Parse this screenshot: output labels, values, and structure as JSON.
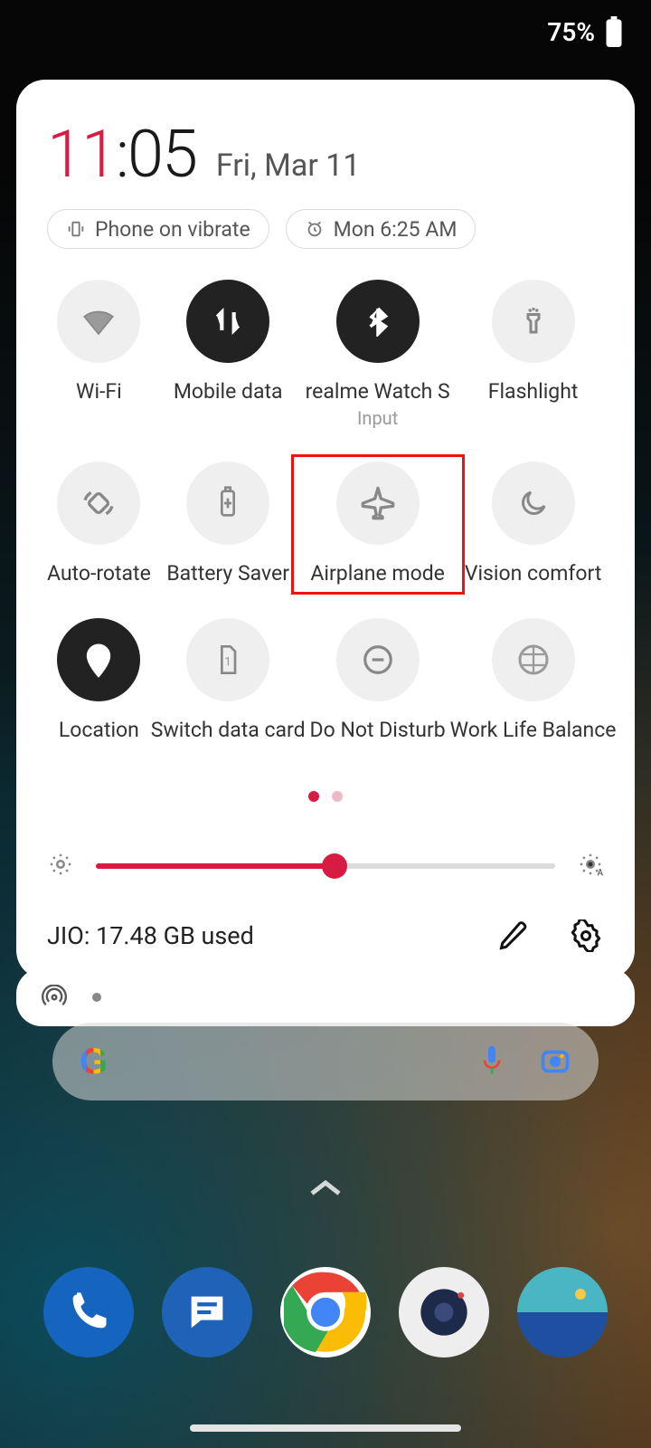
{
  "status": {
    "battery_percent": "75%"
  },
  "clock": {
    "hours": "11",
    "minutes": "05",
    "date": "Fri, Mar 11"
  },
  "chips": {
    "vibrate": "Phone on vibrate",
    "alarm": "Mon 6:25 AM"
  },
  "tiles": [
    {
      "id": "wifi",
      "label": "Wi-Fi",
      "sub": "",
      "active": false,
      "icon": "wifi"
    },
    {
      "id": "mobile-data",
      "label": "Mobile data",
      "sub": "",
      "active": true,
      "icon": "data"
    },
    {
      "id": "bluetooth",
      "label": "realme Watch S",
      "sub": "Input",
      "active": true,
      "icon": "bluetooth"
    },
    {
      "id": "flashlight",
      "label": "Flashlight",
      "sub": "",
      "active": false,
      "icon": "flashlight"
    },
    {
      "id": "auto-rotate",
      "label": "Auto-rotate",
      "sub": "",
      "active": false,
      "icon": "rotate"
    },
    {
      "id": "battery-saver",
      "label": "Battery Saver",
      "sub": "",
      "active": false,
      "icon": "battery"
    },
    {
      "id": "airplane",
      "label": "Airplane mode",
      "sub": "",
      "active": false,
      "icon": "airplane",
      "highlight": true
    },
    {
      "id": "vision",
      "label": "Vision comfort",
      "sub": "",
      "active": false,
      "icon": "moon"
    },
    {
      "id": "location",
      "label": "Location",
      "sub": "",
      "active": true,
      "icon": "pin"
    },
    {
      "id": "switch-sim",
      "label": "Switch data card",
      "sub": "",
      "active": false,
      "icon": "sim"
    },
    {
      "id": "dnd",
      "label": "Do Not Disturb",
      "sub": "",
      "active": false,
      "icon": "dnd"
    },
    {
      "id": "worklife",
      "label": "Work Life Balance",
      "sub": "",
      "active": false,
      "icon": "globe"
    }
  ],
  "brightness": {
    "percent": 52
  },
  "usage": {
    "text": "JIO: 17.48 GB used"
  },
  "colors": {
    "accent": "#d81b43",
    "tile_active": "#222222",
    "tile_inactive": "#efefef",
    "highlight": "#e11111"
  }
}
